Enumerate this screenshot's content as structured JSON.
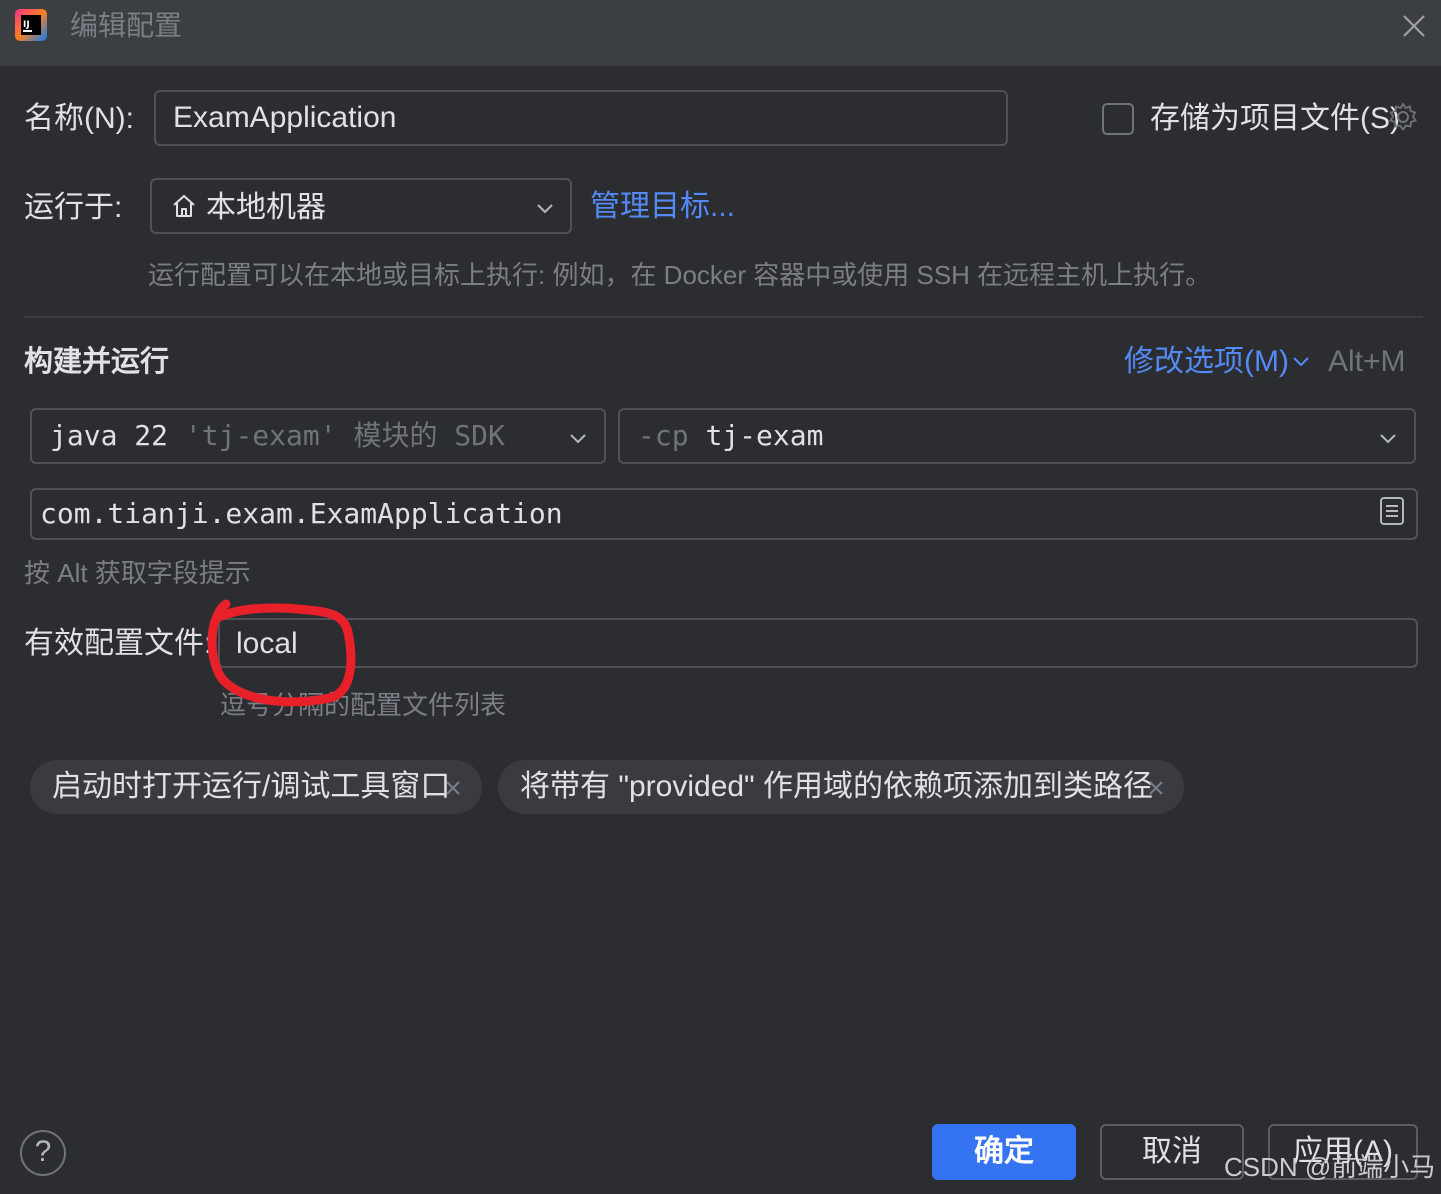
{
  "window": {
    "title": "编辑配置"
  },
  "name_row": {
    "label": "名称(N):",
    "value": "ExamApplication",
    "store_label": "存储为项目文件(S)",
    "store_checked": false
  },
  "run_on": {
    "label": "运行于:",
    "value": "本地机器",
    "manage_link": "管理目标...",
    "hint": "运行配置可以在本地或目标上执行: 例如，在 Docker 容器中或使用 SSH 在远程主机上执行。"
  },
  "build_run": {
    "title": "构建并运行",
    "modify_link": "修改选项(M)",
    "modify_shortcut": "Alt+M",
    "sdk": {
      "version": "java 22",
      "module": "'tj-exam'",
      "suffix": "模块的 SDK"
    },
    "classpath": {
      "flag": "-cp",
      "module": "tj-exam"
    },
    "main_class": "com.tianji.exam.ExamApplication",
    "alt_hint": "按 Alt 获取字段提示"
  },
  "profiles": {
    "label": "有效配置文件:",
    "value": "local",
    "hint": "逗号分隔的配置文件列表"
  },
  "chips": [
    {
      "label": "启动时打开运行/调试工具窗口"
    },
    {
      "label": "将带有 \"provided\" 作用域的依赖项添加到类路径"
    }
  ],
  "footer": {
    "help": "?",
    "ok": "确定",
    "cancel": "取消",
    "apply": "应用(A)"
  },
  "watermark": "CSDN @前端小马",
  "colors": {
    "background": "#2b2d30",
    "accent": "#3574f0",
    "link": "#548af7",
    "annotation": "#e8202a"
  }
}
